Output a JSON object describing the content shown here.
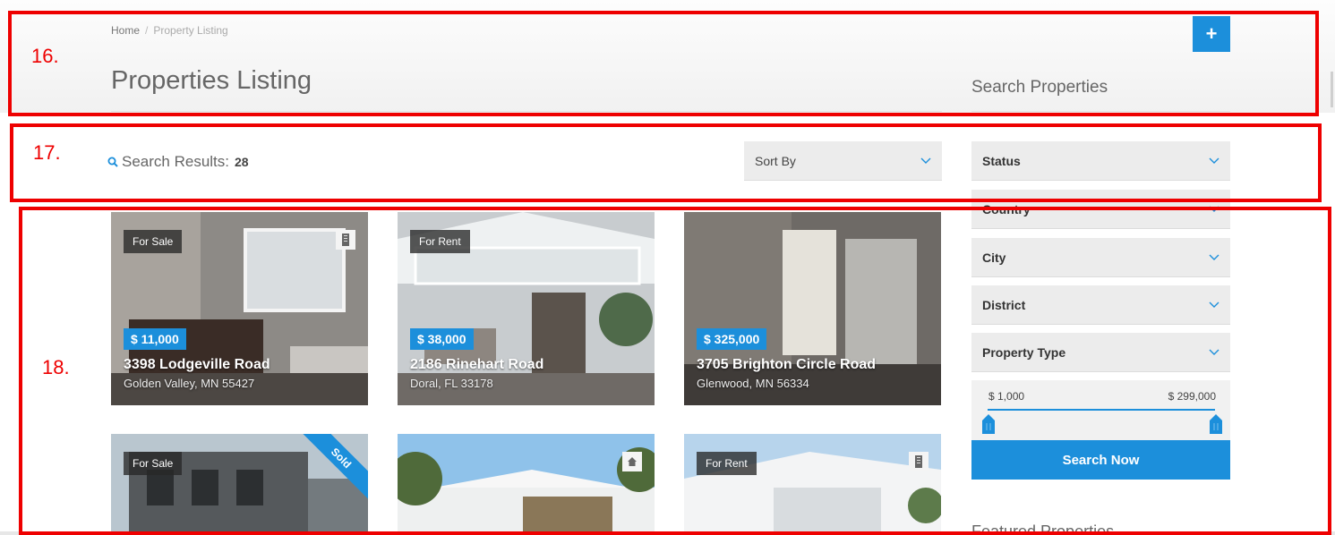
{
  "breadcrumb": {
    "home": "Home",
    "separator": "/",
    "current": "Property Listing"
  },
  "page_title": "Properties Listing",
  "add_button": {
    "label": "+"
  },
  "sidebar": {
    "title": "Search Properties",
    "filters": [
      {
        "label": "Status"
      },
      {
        "label": "Country"
      },
      {
        "label": "City"
      },
      {
        "label": "District"
      },
      {
        "label": "Property Type"
      }
    ],
    "price_range": {
      "min_label": "$ 1,000",
      "max_label": "$ 299,000"
    },
    "search_button": "Search Now",
    "next_section_title": "Featured Properties"
  },
  "results": {
    "label": "Search Results:",
    "count": "28"
  },
  "sort": {
    "label": "Sort By"
  },
  "listings": [
    {
      "status": "For Sale",
      "price": "$ 11,000",
      "address": "3398 Lodgeville Road",
      "city": "Golden Valley, MN 55427",
      "icon": "building-icon"
    },
    {
      "status": "For Rent",
      "price": "$ 38,000",
      "address": "2186 Rinehart Road",
      "city": "Doral, FL 33178",
      "icon": ""
    },
    {
      "status": "",
      "price": "$ 325,000",
      "address": "3705 Brighton Circle Road",
      "city": "Glenwood, MN 56334",
      "icon": ""
    },
    {
      "status": "For Sale",
      "price": "",
      "address": "",
      "city": "",
      "icon": "",
      "ribbon": "Sold"
    },
    {
      "status": "",
      "price": "",
      "address": "",
      "city": "",
      "icon": "home-icon"
    },
    {
      "status": "For Rent",
      "price": "",
      "address": "",
      "city": "",
      "icon": "building-icon"
    }
  ],
  "annotations": [
    {
      "label": "16."
    },
    {
      "label": "17."
    },
    {
      "label": "18."
    }
  ],
  "colors": {
    "accent": "#1c8fdb",
    "annotation": "#ee0000",
    "filter_bg": "#ececec"
  }
}
